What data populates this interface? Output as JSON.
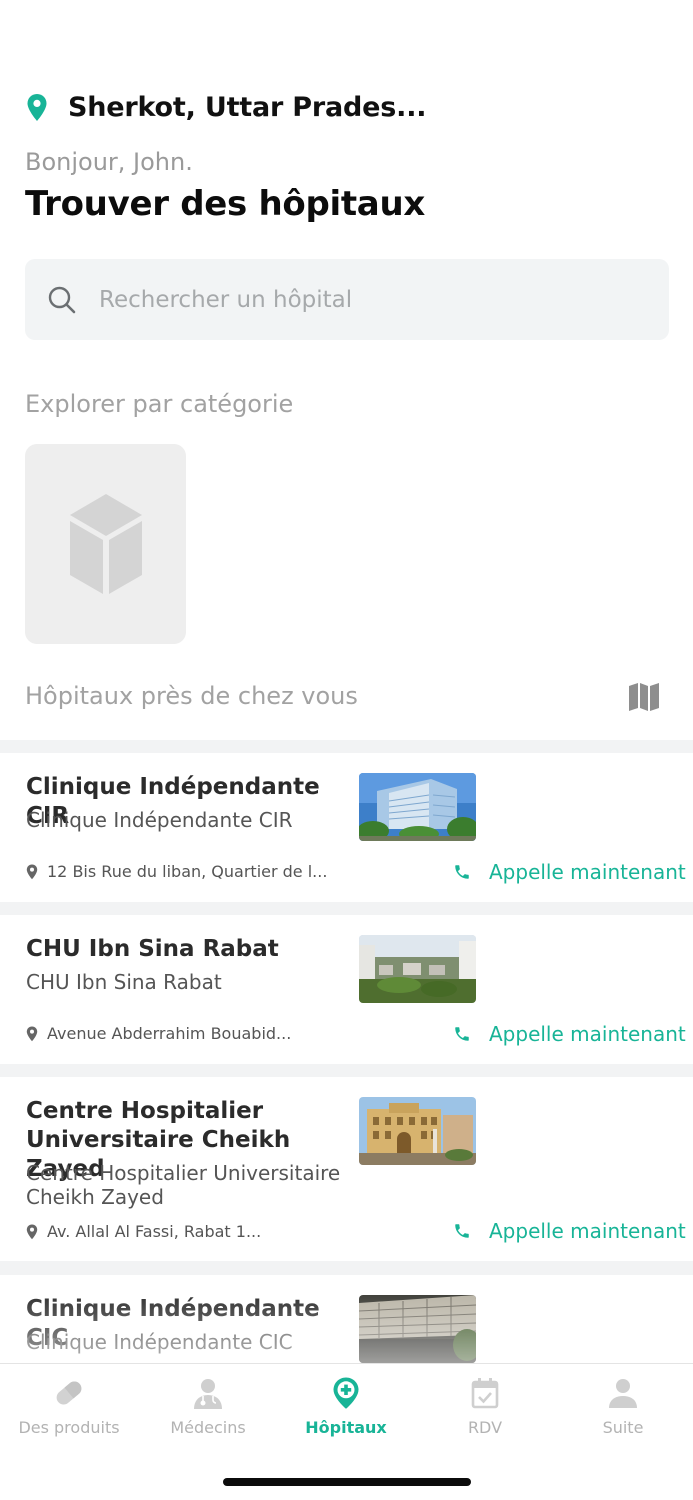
{
  "header": {
    "location": "Sherkot, Uttar Prades...",
    "greeting": "Bonjour, John.",
    "title": "Trouver des hôpitaux"
  },
  "search": {
    "placeholder": "Rechercher un hôpital",
    "value": ""
  },
  "categories": {
    "label": "Explorer par catégorie",
    "items": [
      {
        "icon": "box-placeholder-icon"
      }
    ]
  },
  "nearby": {
    "label": "Hôpitaux près de chez vous",
    "map_icon": "map-icon"
  },
  "hospitals": [
    {
      "name": "Clinique Indépendante CIR",
      "subtitle": "Clinique Indépendante CIR",
      "address": "12 Bis Rue du liban, Quartier de l...",
      "call_label": "Appelle maintenant"
    },
    {
      "name": "CHU Ibn Sina Rabat",
      "subtitle": "CHU Ibn Sina Rabat",
      "address": "Avenue Abderrahim Bouabid...",
      "call_label": "Appelle maintenant"
    },
    {
      "name": "Centre Hospitalier Universitaire Cheikh Zayed",
      "subtitle": "Centre Hospitalier Universitaire Cheikh Zayed",
      "address": "Av. Allal Al Fassi, Rabat 1...",
      "call_label": "Appelle maintenant"
    },
    {
      "name": "Clinique Indépendante CIC",
      "subtitle": "Clinique Indépendante CIC"
    }
  ],
  "tabbar": {
    "tabs": [
      {
        "label": "Des produits",
        "icon": "pill-icon",
        "active": false
      },
      {
        "label": "Médecins",
        "icon": "doctor-icon",
        "active": false
      },
      {
        "label": "Hôpitaux",
        "icon": "hospital-pin-icon",
        "active": true
      },
      {
        "label": "RDV",
        "icon": "calendar-check-icon",
        "active": false
      },
      {
        "label": "Suite",
        "icon": "user-icon",
        "active": false
      }
    ]
  },
  "colors": {
    "accent": "#18b497",
    "muted_text": "#a2a2a2",
    "search_bg": "#f2f4f5",
    "list_bg": "#f2f3f4"
  }
}
